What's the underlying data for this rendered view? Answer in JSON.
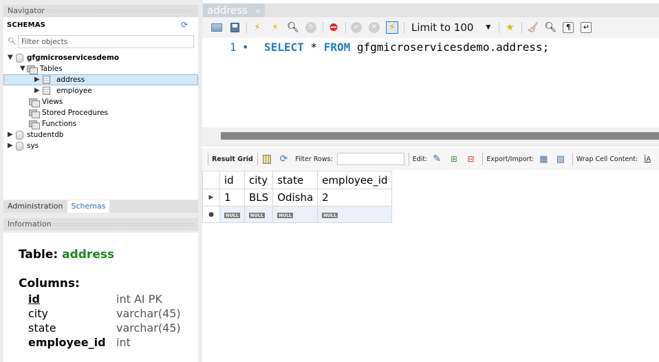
{
  "navigator": {
    "header": "Navigator",
    "schemas_title": "SCHEMAS",
    "filter_placeholder": "Filter objects",
    "tree": {
      "schema_main": "gfgmicroservicesdemo",
      "tables_label": "Tables",
      "tables": [
        "address",
        "employee"
      ],
      "views_label": "Views",
      "procedures_label": "Stored Procedures",
      "functions_label": "Functions",
      "other_schemas": [
        "studentdb",
        "sys"
      ]
    },
    "selected_table": "address"
  },
  "bottom_tabs": {
    "administration": "Administration",
    "schemas": "Schemas",
    "active": "Schemas"
  },
  "information": {
    "header": "Information",
    "table_label": "Table:",
    "table_name": "address",
    "columns_label": "Columns:",
    "columns": [
      {
        "name": "id",
        "type": "int AI PK"
      },
      {
        "name": "city",
        "type": "varchar(45)"
      },
      {
        "name": "state",
        "type": "varchar(45)"
      },
      {
        "name": "employee_id",
        "type": "int"
      }
    ]
  },
  "editor": {
    "tab_title": "address",
    "tab_close": "×",
    "limit_select": "Limit to 100",
    "line_number": "1",
    "line_marker": "•",
    "sql": {
      "kw_select": "SELECT",
      "star": " * ",
      "kw_from": "FROM",
      "rest": " gfgmicroservicesdemo.address;"
    }
  },
  "result_toolbar": {
    "result_grid": "Result Grid",
    "filter_rows": "Filter Rows:",
    "edit": "Edit:",
    "export_import": "Export/Import:",
    "wrap_cell": "Wrap Cell Content:",
    "wrap_icon_text": "ĪA"
  },
  "result_grid": {
    "columns": [
      "id",
      "city",
      "state",
      "employee_id"
    ],
    "rows": [
      [
        "1",
        "BLS",
        "Odisha",
        "2"
      ]
    ],
    "new_row_marker": "●",
    "current_row_marker": "▶",
    "null_label": "NULL"
  },
  "colors": {
    "keyword_blue": "#1f7fc0",
    "table_name_green": "#1a8a1a",
    "selection_bg": "#d5e8f8"
  }
}
